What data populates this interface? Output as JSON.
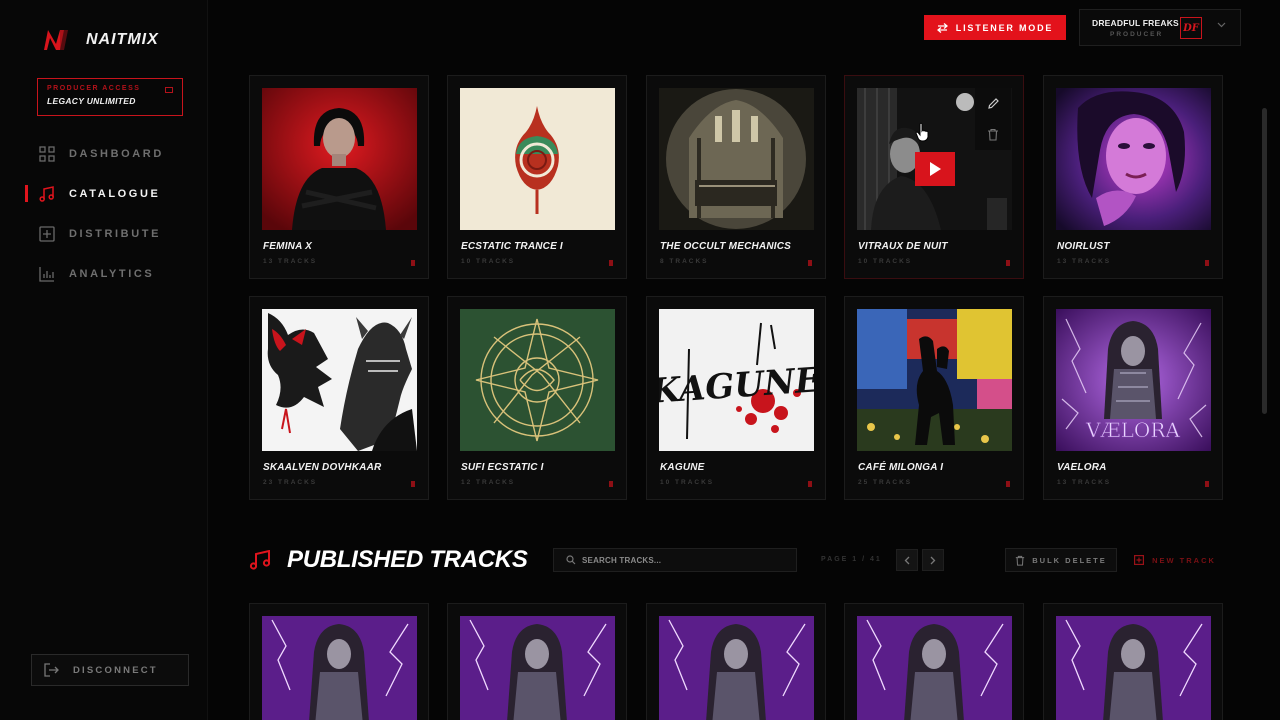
{
  "brand": {
    "name": "NAITMIX",
    "accent": "#e3121b"
  },
  "access": {
    "title": "PRODUCER ACCESS",
    "plan": "LEGACY UNLIMITED"
  },
  "nav": {
    "items": [
      {
        "label": "DASHBOARD",
        "icon": "grid-icon",
        "active": false
      },
      {
        "label": "CATALOGUE",
        "icon": "music-note-icon",
        "active": true
      },
      {
        "label": "DISTRIBUTE",
        "icon": "plus-square-icon",
        "active": false
      },
      {
        "label": "ANALYTICS",
        "icon": "bar-chart-icon",
        "active": false
      }
    ],
    "disconnect": "DISCONNECT"
  },
  "topbar": {
    "listener_mode": "LISTENER MODE",
    "user_name": "DREADFUL FREAKS",
    "user_role": "PRODUCER",
    "avatar_initials": "DF"
  },
  "albums": [
    {
      "title": "FEMINA X",
      "tracks": "13 TRACKS"
    },
    {
      "title": "ECSTATIC TRANCE I",
      "tracks": "10 TRACKS"
    },
    {
      "title": "THE OCCULT MECHANICS",
      "tracks": "8 TRACKS"
    },
    {
      "title": "VITRAUX DE NUIT",
      "tracks": "10 TRACKS"
    },
    {
      "title": "NOIRLUST",
      "tracks": "13 TRACKS"
    },
    {
      "title": "SKAALVEN DOVHKAAR",
      "tracks": "23 TRACKS"
    },
    {
      "title": "SUFI ECSTATIC I",
      "tracks": "12 TRACKS"
    },
    {
      "title": "KAGUNE",
      "tracks": "10 TRACKS"
    },
    {
      "title": "CAFÉ MILONGA I",
      "tracks": "25 TRACKS"
    },
    {
      "title": "VAELORA",
      "tracks": "13 TRACKS"
    }
  ],
  "published": {
    "title": "PUBLISHED TRACKS",
    "search_placeholder": "SEARCH TRACKS...",
    "page_info": "PAGE 1 / 41",
    "bulk_delete": "BULK DELETE",
    "new_track": "NEW TRACK",
    "art_texts": {
      "kagune": "KAGUNE",
      "vaelora": "VÆLORA"
    }
  }
}
